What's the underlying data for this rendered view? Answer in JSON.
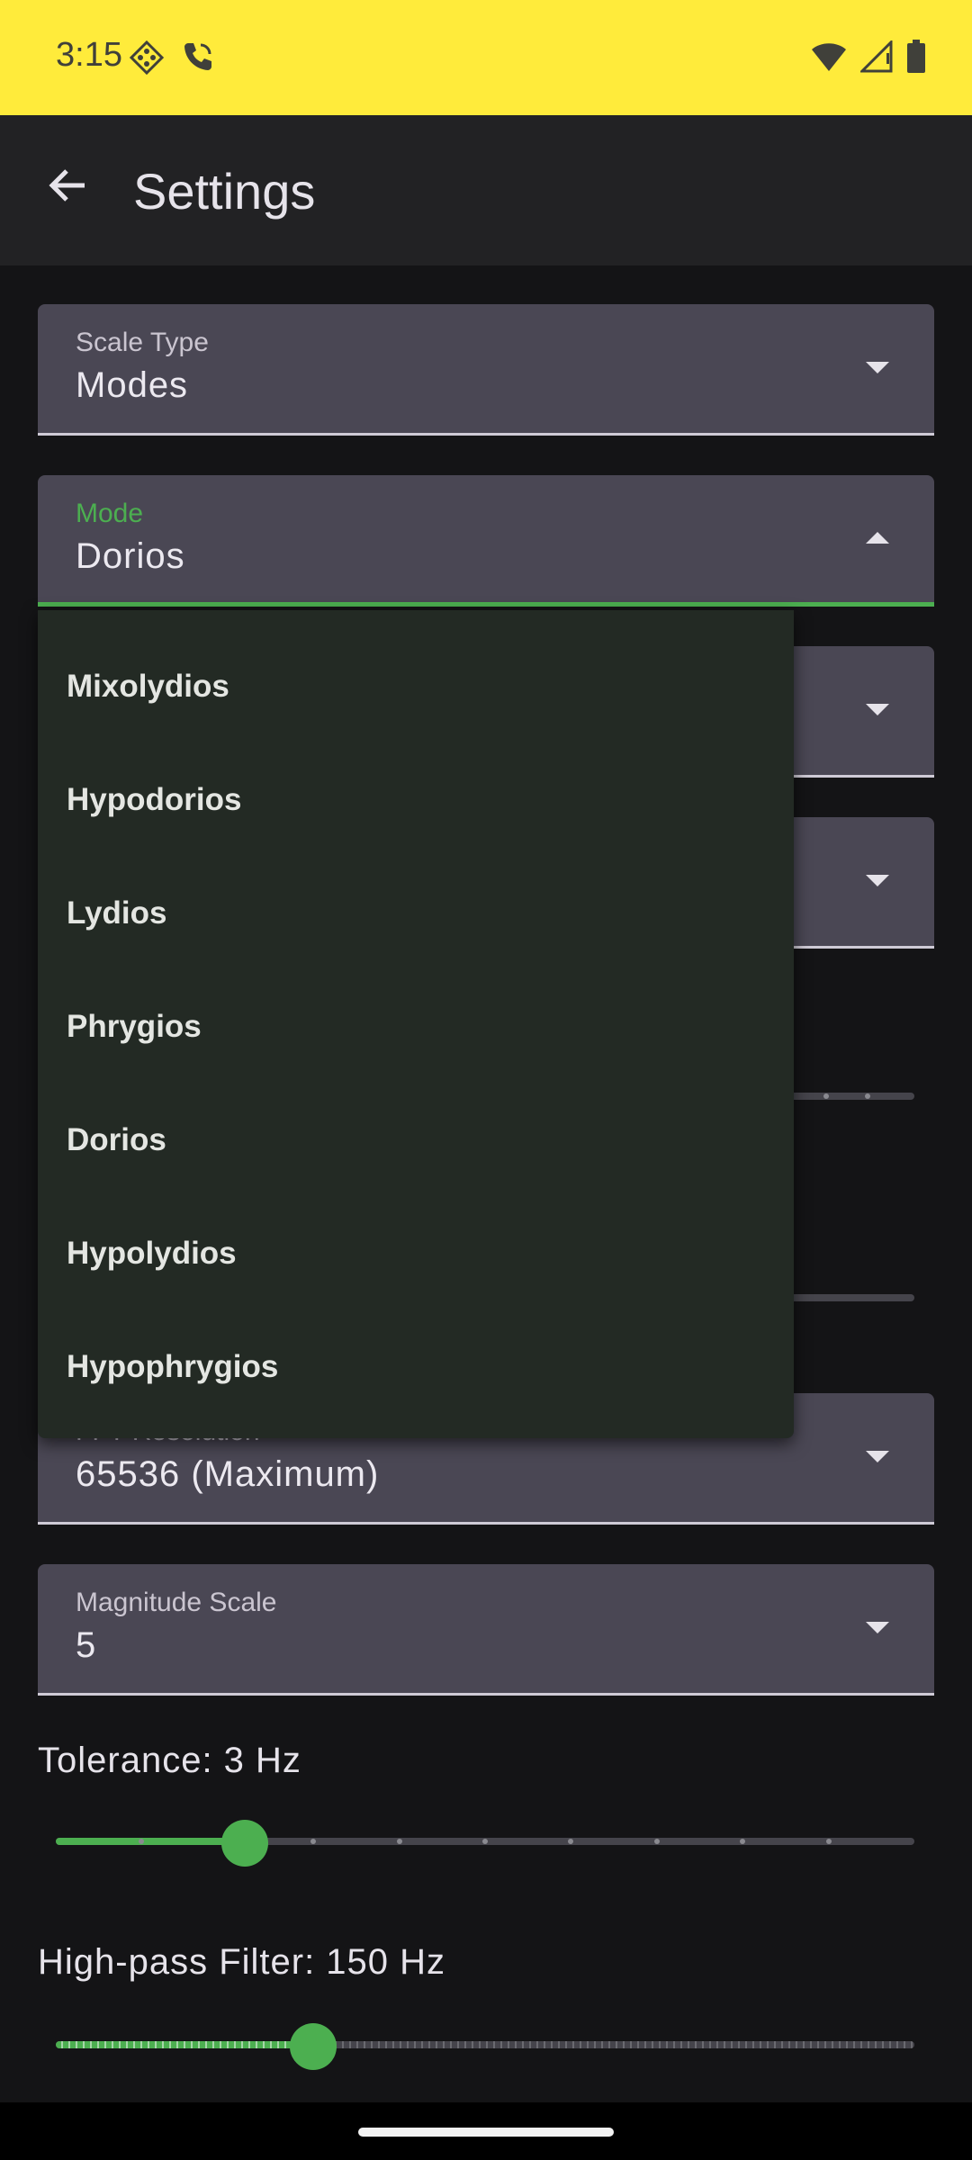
{
  "status_bar": {
    "time": "3:15",
    "bg_color": "#ffeb3b"
  },
  "app_bar": {
    "title": "Settings"
  },
  "fields": {
    "scale_type": {
      "label": "Scale Type",
      "value": "Modes"
    },
    "mode": {
      "label": "Mode",
      "value": "Dorios"
    },
    "fft_resolution": {
      "label": "FFT Resolution",
      "value": "65536 (Maximum)"
    },
    "magnitude_scale": {
      "label": "Magnitude Scale",
      "value": "5"
    }
  },
  "sliders": {
    "tolerance": {
      "label": "Tolerance: 3 Hz",
      "fraction": 0.22
    },
    "high_pass": {
      "label": "High-pass Filter: 150 Hz",
      "fraction": 0.3
    }
  },
  "mode_menu": {
    "items": [
      "Mixolydios",
      "Hypodorios",
      "Lydios",
      "Phrygios",
      "Dorios",
      "Hypolydios",
      "Hypophrygios"
    ]
  },
  "accent_color": "#4caf50"
}
